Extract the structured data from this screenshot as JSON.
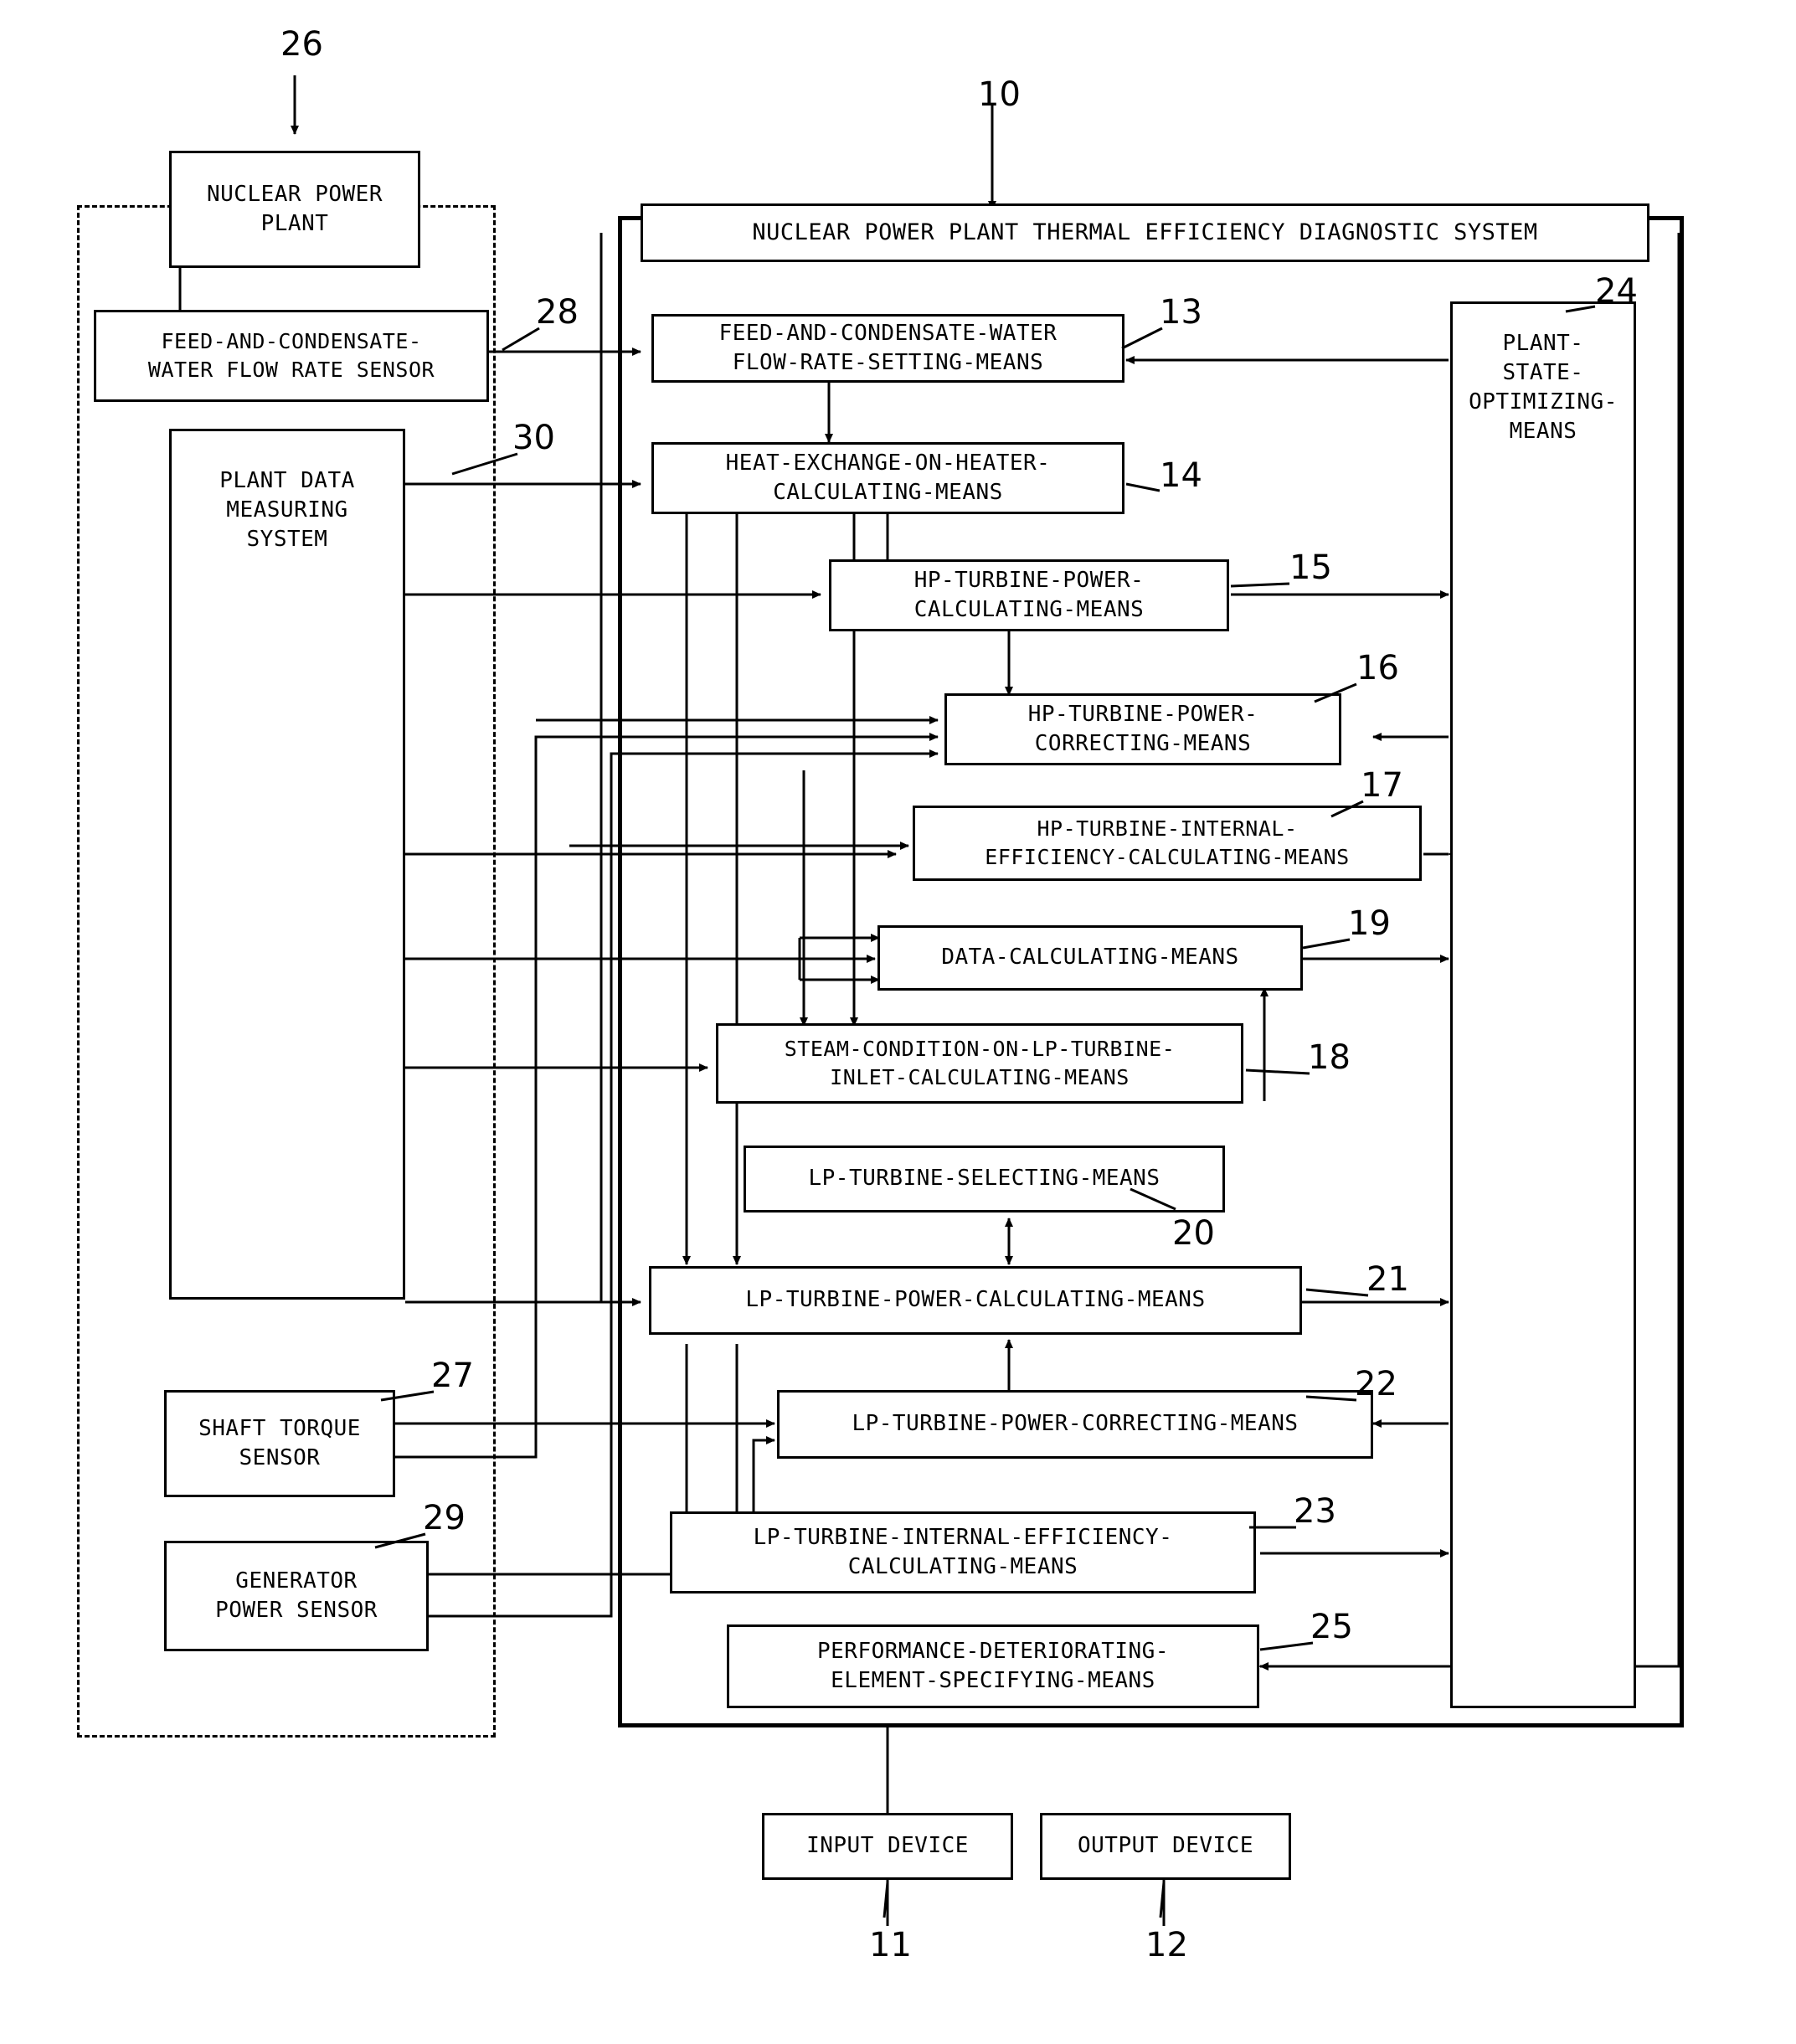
{
  "title": "Nuclear power plant thermal efficiency diagnostic system block diagram",
  "boxes": {
    "nuclear_power_plant": "NUCLEAR POWER\nPLANT",
    "feed_flow_sensor": "FEED-AND-CONDENSATE-\nWATER FLOW RATE SENSOR",
    "plant_data_measuring": "PLANT DATA\nMEASURING\nSYSTEM",
    "shaft_torque_sensor": "SHAFT TORQUE\nSENSOR",
    "generator_power_sensor": "GENERATOR\nPOWER SENSOR",
    "system_title": "NUCLEAR POWER PLANT THERMAL EFFICIENCY DIAGNOSTIC SYSTEM",
    "feed_setting_means": "FEED-AND-CONDENSATE-WATER\nFLOW-RATE-SETTING-MEANS",
    "heat_exchange_means": "HEAT-EXCHANGE-ON-HEATER-\nCALCULATING-MEANS",
    "hp_power_calc": "HP-TURBINE-POWER-\nCALCULATING-MEANS",
    "hp_power_correct": "HP-TURBINE-POWER-\nCORRECTING-MEANS",
    "hp_internal_eff": "HP-TURBINE-INTERNAL-\nEFFICIENCY-CALCULATING-MEANS",
    "data_calculating": "DATA-CALCULATING-MEANS",
    "steam_condition": "STEAM-CONDITION-ON-LP-TURBINE-\nINLET-CALCULATING-MEANS",
    "lp_selecting": "LP-TURBINE-SELECTING-MEANS",
    "lp_power_calc": "LP-TURBINE-POWER-CALCULATING-MEANS",
    "lp_power_correct": "LP-TURBINE-POWER-CORRECTING-MEANS",
    "lp_internal_eff": "LP-TURBINE-INTERNAL-EFFICIENCY-\nCALCULATING-MEANS",
    "performance_deteriorating": "PERFORMANCE-DETERIORATING-\nELEMENT-SPECIFYING-MEANS",
    "plant_state_optimizing": "PLANT-\nSTATE-\nOPTIMIZING-\nMEANS",
    "input_device": "INPUT DEVICE",
    "output_device": "OUTPUT DEVICE"
  },
  "refs": {
    "r10": "10",
    "r11": "11",
    "r12": "12",
    "r13": "13",
    "r14": "14",
    "r15": "15",
    "r16": "16",
    "r17": "17",
    "r18": "18",
    "r19": "19",
    "r20": "20",
    "r21": "21",
    "r22": "22",
    "r23": "23",
    "r24": "24",
    "r25": "25",
    "r26": "26",
    "r27": "27",
    "r28": "28",
    "r29": "29",
    "r30": "30"
  }
}
